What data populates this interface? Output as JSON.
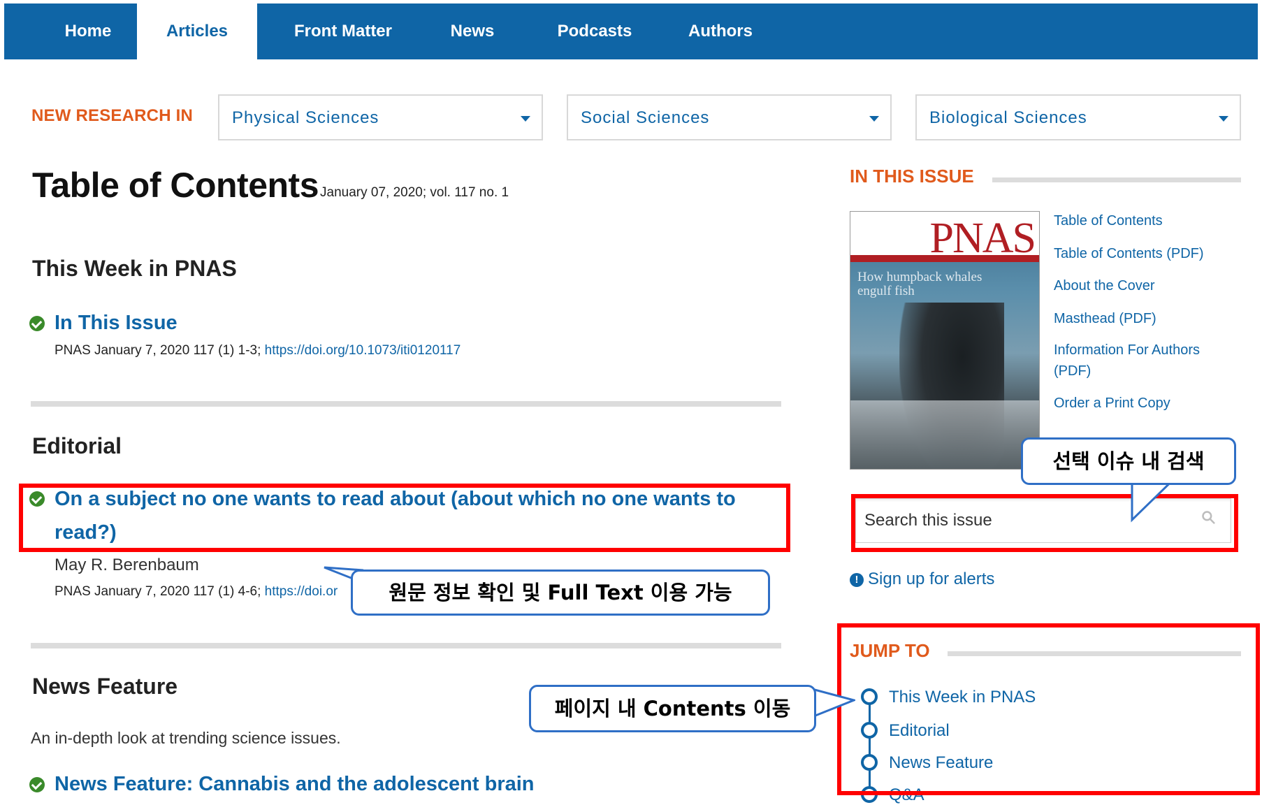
{
  "nav": {
    "items": [
      "Home",
      "Articles",
      "Front Matter",
      "News",
      "Podcasts",
      "Authors"
    ],
    "active": "Articles"
  },
  "new_research": {
    "label": "NEW RESEARCH IN",
    "dropdowns": [
      "Physical Sciences",
      "Social Sciences",
      "Biological Sciences"
    ]
  },
  "toc": {
    "title": "Table of Contents",
    "date": "January 07, 2020; vol. 117 no. 1"
  },
  "sections": {
    "this_week": {
      "heading": "This Week in PNAS",
      "article_title": "In This Issue",
      "citation": "PNAS January 7, 2020 117 (1) 1-3; ",
      "doi": "https://doi.org/10.1073/iti0120117"
    },
    "editorial": {
      "heading": "Editorial",
      "article_title_line1": "On a subject no one wants to read about (about which no one wants to",
      "article_title_line2": "read?)",
      "author": "May R. Berenbaum",
      "citation": "PNAS January 7, 2020 117 (1) 4-6; ",
      "doi": "https://doi.or"
    },
    "news_feature": {
      "heading": "News Feature",
      "description": "An in-depth look at trending science issues.",
      "article_title": "News Feature: Cannabis and the adolescent brain"
    }
  },
  "sidebar": {
    "in_this_issue": "IN THIS ISSUE",
    "cover": {
      "masthead": "PNAS",
      "headline": "How humpback whales engulf fish"
    },
    "links": [
      "Table of Contents",
      "Table of Contents (PDF)",
      "About the Cover",
      "Masthead (PDF)",
      "Information For Authors",
      "(PDF)",
      "Order a Print Copy"
    ],
    "search_placeholder": "Search this issue",
    "alert_link": "Sign up for alerts",
    "jump_to": "JUMP TO",
    "jump_items": [
      "This Week in PNAS",
      "Editorial",
      "News Feature",
      "Q&A"
    ]
  },
  "annotations": {
    "search_callout": "선택 이슈 내 검색",
    "fulltext_callout": "원문 정보 확인 및 Full Text 이용 가능",
    "jump_callout": "페이지 내 Contents 이동"
  },
  "colors": {
    "nav_bg": "#0f65a6",
    "accent_orange": "#e05a1c",
    "link_blue": "#0f65a6",
    "highlight_red": "#ff0000",
    "callout_border": "#2f6fc6",
    "check_green": "#3a8a2a"
  }
}
